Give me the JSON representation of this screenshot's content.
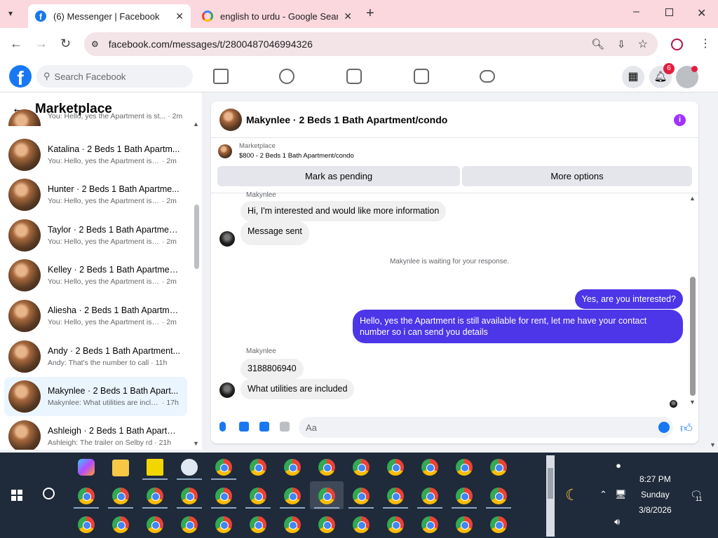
{
  "browser": {
    "tabs": [
      {
        "title": "(6) Messenger | Facebook"
      },
      {
        "title": "english to urdu - Google Search"
      }
    ],
    "url": "facebook.com/messages/t/2800487046994326"
  },
  "fb": {
    "search_placeholder": "Search Facebook",
    "notifications_count": "6"
  },
  "sidebar": {
    "title": "Marketplace",
    "partial_preview": "You: Hello, yes the Apartment is st... · 2m",
    "conversations": [
      {
        "title": "Katalina · 2 Beds 1 Bath Apartm...",
        "preview": "You: Hello, yes the Apartment is st...",
        "time": "· 2m"
      },
      {
        "title": "Hunter · 2 Beds 1 Bath Apartme...",
        "preview": "You: Hello, yes the Apartment is st...",
        "time": "· 2m"
      },
      {
        "title": "Taylor · 2 Beds 1 Bath Apartmen...",
        "preview": "You: Hello, yes the Apartment is st...",
        "time": "· 2m"
      },
      {
        "title": "Kelley · 2 Beds 1 Bath Apartmen...",
        "preview": "You: Hello, yes the Apartment is st...",
        "time": "· 2m"
      },
      {
        "title": "Aliesha · 2 Beds 1 Bath Apartme...",
        "preview": "You: Hello, yes the Apartment is st...",
        "time": "· 2m"
      },
      {
        "title": "Andy · 2 Beds 1 Bath Apartment...",
        "preview": "Andy: That's the number to call",
        "time": "· 11h"
      },
      {
        "title": "Makynlee · 2 Beds 1 Bath Apart...",
        "preview": "Makynlee: What utilities are inclu...",
        "time": "· 17h"
      },
      {
        "title": "Ashleigh · 2 Beds 1 Bath Apartm...",
        "preview": "Ashleigh: The trailer on Selby rd",
        "time": "· 21h"
      }
    ]
  },
  "chat": {
    "title": "Makynlee · 2 Beds 1 Bath Apartment/condo",
    "marketplace_label": "Marketplace",
    "listing": "$800 - 2 Beds 1 Bath Apartment/condo",
    "mark_pending": "Mark as pending",
    "more_options": "More options",
    "sender_name": "Makynlee",
    "msg1": "Hi, I'm interested and would like more information",
    "msg2": "Message sent",
    "system_msg": "Makynlee is waiting for your response.",
    "out1": "Yes, are you interested?",
    "out2": "Hello, yes the Apartment is still available for rent, let me have your contact number so i can send you details",
    "sender_name2": "Makynlee",
    "msg3": "3188806940",
    "msg4": "What utilities are included",
    "input_placeholder": "Aa"
  },
  "taskbar": {
    "time": "8:27 PM",
    "day": "Sunday",
    "date": "3/8/2026",
    "notif_count": "11"
  }
}
